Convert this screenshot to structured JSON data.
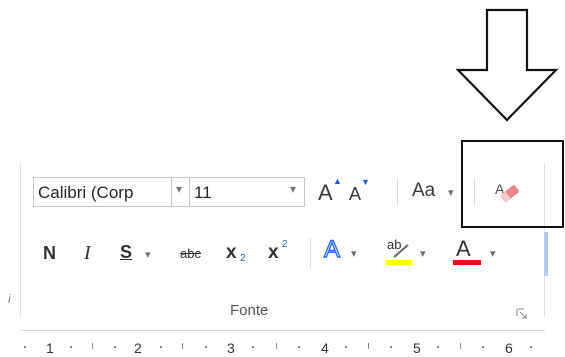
{
  "font_group": {
    "font_name": {
      "value": "Calibri (Corp",
      "arrow": "▾"
    },
    "font_size": {
      "value": "11",
      "arrow": "▾"
    },
    "grow_font": {
      "letter": "A",
      "mark": "▲"
    },
    "shrink_font": {
      "letter": "A",
      "mark": "▼"
    },
    "change_case": {
      "label": "Aa",
      "arrow": "▾"
    },
    "bold": "N",
    "italic": "I",
    "underline": {
      "label": "S",
      "arrow": "▾"
    },
    "strikethrough": "abc",
    "subscript": {
      "base": "x",
      "sub": "2"
    },
    "superscript": {
      "base": "x",
      "sup": "2"
    },
    "text_effects": {
      "letter": "A",
      "arrow": "▾"
    },
    "highlight": {
      "label": "ab",
      "arrow": "▾",
      "color": "#ffff00"
    },
    "font_color": {
      "letter": "A",
      "arrow": "▾",
      "color": "#e81123"
    },
    "label": "Fonte"
  },
  "left_marker": "i",
  "ruler": {
    "numbers": [
      "1",
      "2",
      "3",
      "4",
      "5",
      "6"
    ]
  },
  "icons": {
    "clear_formatting": "eraser-icon",
    "launcher": "dialog-launcher-icon",
    "callout": "down-arrow-icon"
  }
}
